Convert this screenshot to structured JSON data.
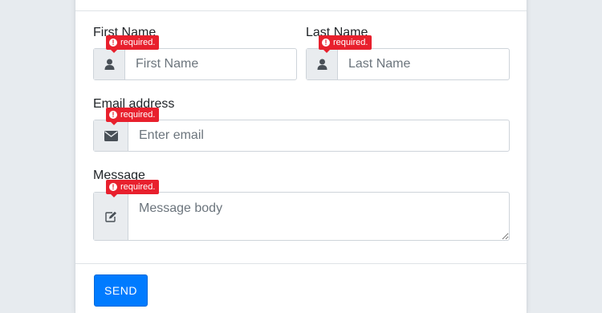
{
  "form": {
    "first_name": {
      "label": "First Name",
      "placeholder": "First Name",
      "icon": "user-icon",
      "error": "required."
    },
    "last_name": {
      "label": "Last Name",
      "placeholder": "Last Name",
      "icon": "user-icon",
      "error": "required."
    },
    "email": {
      "label": "Email address",
      "placeholder": "Enter email",
      "icon": "envelope-icon",
      "error": "required."
    },
    "message": {
      "label": "Message",
      "placeholder": "Message body",
      "icon": "edit-icon",
      "error": "required."
    },
    "submit_label": "SEND"
  },
  "colors": {
    "error": "#e8202d",
    "primary": "#007bff",
    "page_background": "#e7ebef"
  }
}
